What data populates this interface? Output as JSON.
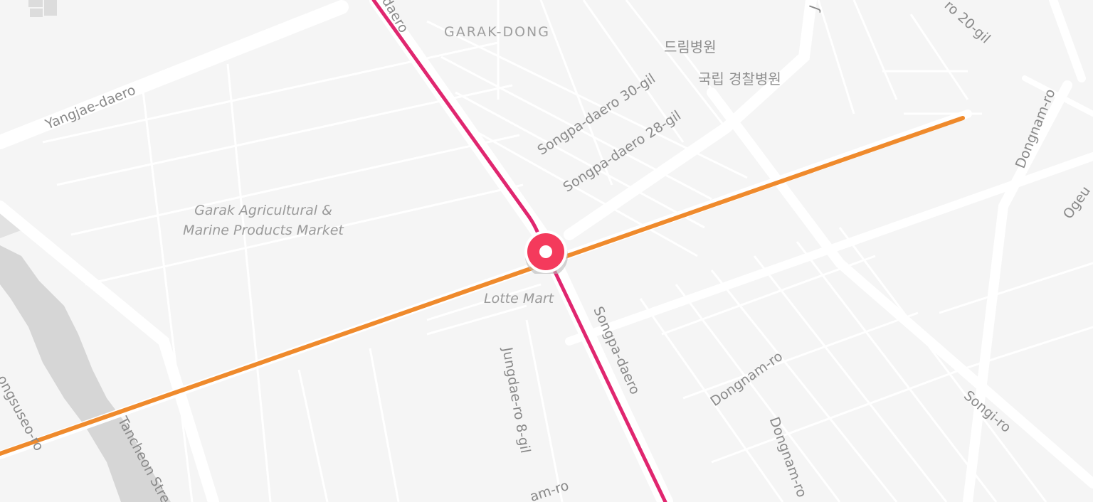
{
  "map": {
    "area_labels": {
      "garak_dong": "GARAK-DONG"
    },
    "poi_labels": {
      "market_line1": "Garak Agricultural &",
      "market_line2": "Marine Products Market",
      "lotte_mart": "Lotte Mart",
      "dream_hospital": "드림병원",
      "police_hospital": "국립 경찰병원"
    },
    "road_labels": {
      "daero_top": "daero",
      "yangjae": "Yangjae-daero",
      "songpa_30": "Songpa-daero 30-gil",
      "songpa_28": "Songpa-daero 28-gil",
      "songpa_daero": "Songpa-daero",
      "jungdae_8": "Jungdae-ro 8-gil",
      "dongnam_mid": "Dongnam-ro",
      "dongnam_vertical": "Dongnam-ro",
      "dongnam_right": "Dongnam-ro",
      "songi": "Songi-ro",
      "ogeum": "Ogeu",
      "tancheon": "Tancheon Stre",
      "seongsuseo": "ongsuseo-ro",
      "gil_20": "ro 20-gil",
      "j_top": "J",
      "nam_ro_bottom": "am-ro"
    },
    "routes": [
      {
        "name": "pink-line",
        "color": "#e0266f"
      },
      {
        "name": "orange-line",
        "color": "#ef8a2c"
      }
    ],
    "marker": {
      "icon": "station-marker-icon",
      "color": "#f43a5c"
    },
    "colors": {
      "background": "#f5f5f5",
      "roads": "#ffffff",
      "river": "#d6d6d6"
    }
  }
}
